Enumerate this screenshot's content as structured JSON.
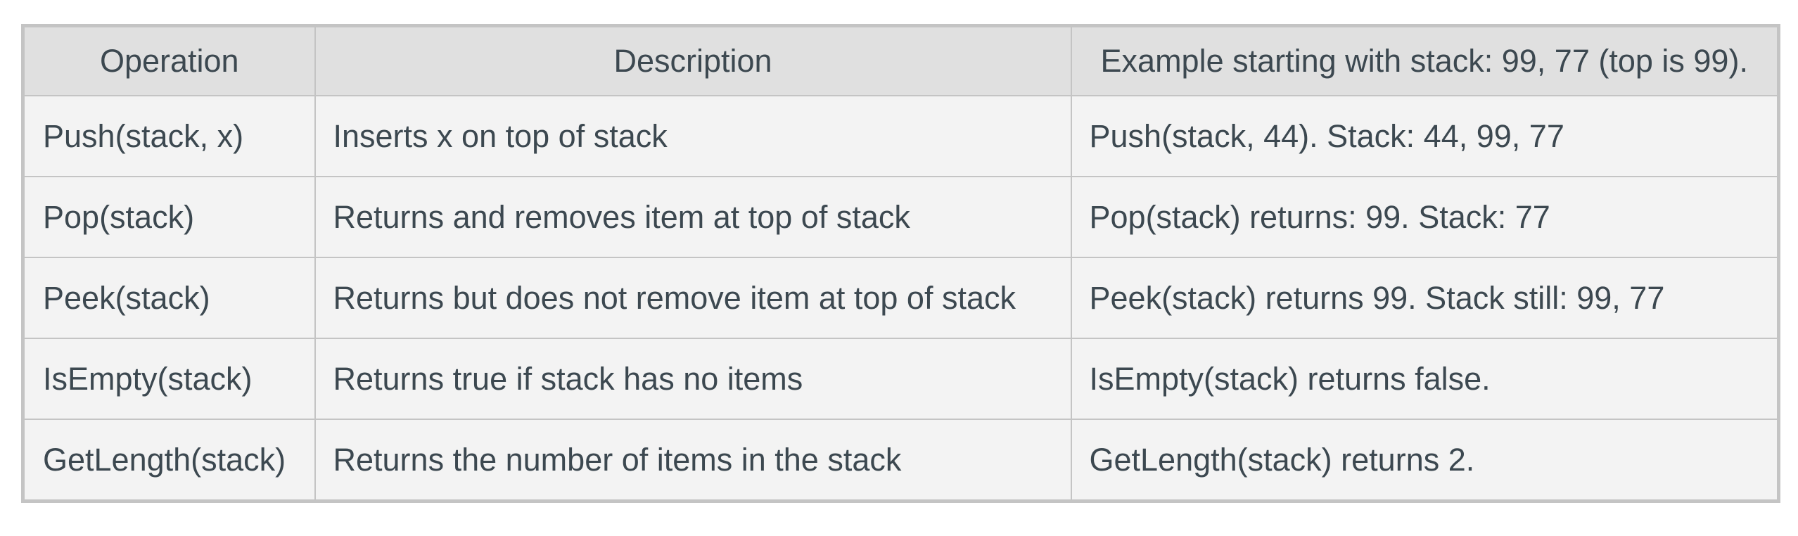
{
  "table": {
    "headers": [
      "Operation",
      "Description",
      "Example starting with stack: 99, 77 (top is 99)."
    ],
    "rows": [
      [
        "Push(stack, x)",
        "Inserts x on top of stack",
        "Push(stack, 44). Stack: 44, 99, 77"
      ],
      [
        "Pop(stack)",
        "Returns and removes item at top of stack",
        "Pop(stack) returns: 99. Stack: 77"
      ],
      [
        "Peek(stack)",
        "Returns but does not remove item at top of stack",
        "Peek(stack) returns 99. Stack still: 99, 77"
      ],
      [
        "IsEmpty(stack)",
        "Returns true if stack has no items",
        "IsEmpty(stack) returns false."
      ],
      [
        "GetLength(stack)",
        "Returns the number of items in the stack",
        "GetLength(stack) returns 2."
      ]
    ]
  },
  "colors": {
    "header_bg": "#e0e0e0",
    "cell_bg": "#f3f3f3",
    "border": "#c4c4c4",
    "text": "#3c4850"
  }
}
